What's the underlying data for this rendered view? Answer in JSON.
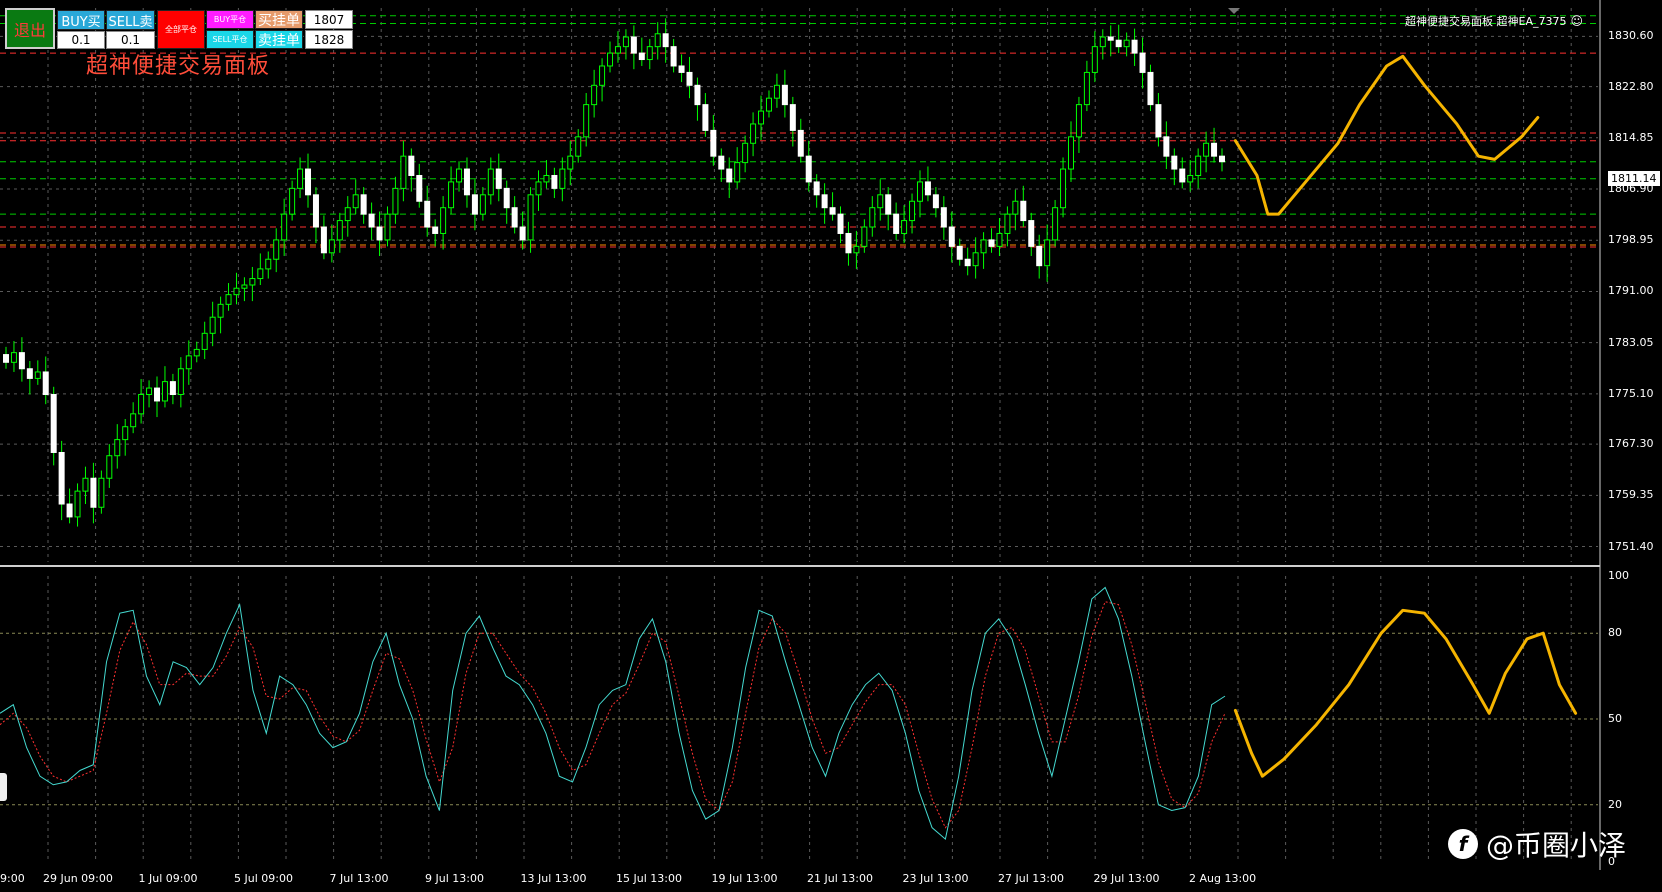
{
  "toolbar": {
    "exit_label": "退出",
    "buy_label": "BUY买",
    "sell_label": "SELL卖",
    "buy_lot": "0.1",
    "sell_lot": "0.1",
    "close_all_label": "全部平仓",
    "buy_close_label": "BUY平仓",
    "sell_close_label": "SELL平仓",
    "buy_pending_label": "买挂单",
    "sell_pending_label": "卖挂单",
    "buy_pending_price": "1807",
    "sell_pending_price": "1828",
    "colors": {
      "exit": "#0a7a12",
      "buy": "#29a8d8",
      "sell": "#29a8d8",
      "close_all": "#ff0000",
      "buy_close": "#ff1cff",
      "sell_close": "#1ad7e8",
      "buy_pending": "#e69a6b",
      "sell_pending": "#1ad7e8"
    }
  },
  "panel_title": "超神便捷交易面板",
  "ea_label": "超神便捷交易面板 超神EA_7375",
  "watermark": "@币圈小泽",
  "current_price": "1811.14",
  "chart_data": [
    {
      "type": "candlestick",
      "y_ticks": [
        "1830.60",
        "1822.80",
        "1814.85",
        "1806.90",
        "1798.95",
        "1791.00",
        "1783.05",
        "1775.10",
        "1767.30",
        "1759.35",
        "1751.40"
      ],
      "x_ticks": [
        "29 Jun 09:00",
        "1 Jul 09:00",
        "5 Jul 09:00",
        "7 Jul 13:00",
        "9 Jul 13:00",
        "13 Jul 13:00",
        "15 Jul 13:00",
        "19 Jul 13:00",
        "21 Jul 13:00",
        "23 Jul 13:00",
        "27 Jul 13:00",
        "29 Jul 13:00",
        "2 Aug 13:00"
      ],
      "x_tick_prefix": "9:00",
      "ylim": [
        1749,
        1835
      ],
      "grid": true,
      "bull_color": "#00ff00",
      "bear_color": "#ffffff",
      "h_levels": [
        {
          "price": 1833.8,
          "color": "#00cc00"
        },
        {
          "price": 1832.6,
          "color": "#00cc00"
        },
        {
          "price": 1828.0,
          "color": "#ff3030"
        },
        {
          "price": 1815.6,
          "color": "#ff3030"
        },
        {
          "price": 1814.4,
          "color": "#ff3030"
        },
        {
          "price": 1811.14,
          "color": "#00cc00"
        },
        {
          "price": 1808.5,
          "color": "#00cc00"
        },
        {
          "price": 1803.0,
          "color": "#00cc00"
        },
        {
          "price": 1801.0,
          "color": "#ff3030"
        },
        {
          "price": 1798.2,
          "color": "#ff8c00"
        },
        {
          "price": 1797.9,
          "color": "#ff3030"
        }
      ],
      "forecast_path": [
        [
          1,
          1814.4
        ],
        [
          5,
          1809
        ],
        [
          7,
          1803
        ],
        [
          9,
          1803
        ],
        [
          14,
          1808
        ],
        [
          20,
          1814
        ],
        [
          24,
          1820
        ],
        [
          29,
          1826
        ],
        [
          32,
          1827.5
        ],
        [
          36,
          1823
        ],
        [
          42,
          1817
        ],
        [
          46,
          1812
        ],
        [
          49,
          1811.5
        ],
        [
          54,
          1815
        ],
        [
          57,
          1818
        ]
      ],
      "closes": [
        1780.0,
        1781.5,
        1779.0,
        1777.5,
        1778.5,
        1775.0,
        1766.0,
        1758.0,
        1756.0,
        1760.0,
        1762.0,
        1757.5,
        1762.0,
        1765.5,
        1768.0,
        1770.0,
        1772.0,
        1775.0,
        1776.0,
        1774.0,
        1777.0,
        1775.0,
        1779.0,
        1781.0,
        1782.0,
        1784.5,
        1787.0,
        1789.0,
        1790.5,
        1791.5,
        1792.0,
        1793.0,
        1794.5,
        1796.0,
        1799.0,
        1803.0,
        1807.0,
        1810.0,
        1806.0,
        1801.0,
        1797.0,
        1799.0,
        1802.0,
        1804.0,
        1806.0,
        1803.0,
        1801.0,
        1799.0,
        1803.0,
        1807.0,
        1812.0,
        1809.0,
        1805.0,
        1801.0,
        1800.0,
        1804.0,
        1808.0,
        1810.0,
        1806.0,
        1803.0,
        1806.0,
        1810.0,
        1807.0,
        1804.0,
        1801.0,
        1799.0,
        1806.0,
        1808.0,
        1809.0,
        1807.0,
        1810.0,
        1812.0,
        1815.0,
        1820.0,
        1823.0,
        1826.0,
        1828.0,
        1829.0,
        1830.5,
        1828.0,
        1827.0,
        1829.0,
        1831.0,
        1829.0,
        1826.0,
        1825.0,
        1823.0,
        1820.0,
        1816.0,
        1812.0,
        1810.0,
        1808.0,
        1811.0,
        1814.0,
        1817.0,
        1819.0,
        1821.0,
        1823.0,
        1820.0,
        1816.0,
        1812.0,
        1808.0,
        1806.0,
        1804.0,
        1803.0,
        1800.0,
        1797.0,
        1798.0,
        1801.0,
        1804.0,
        1806.0,
        1803.0,
        1800.0,
        1802.0,
        1805.0,
        1808.0,
        1806.0,
        1804.0,
        1801.0,
        1798.0,
        1796.0,
        1795.0,
        1797.0,
        1799.0,
        1798.0,
        1800.0,
        1803.0,
        1805.0,
        1802.0,
        1798.0,
        1795.0,
        1799.0,
        1804.0,
        1810.0,
        1815.0,
        1820.0,
        1825.0,
        1829.0,
        1830.5,
        1830.0,
        1829.0,
        1830.0,
        1828.0,
        1825.0,
        1820.0,
        1815.0,
        1812.0,
        1810.0,
        1808.0,
        1809.0,
        1812.0,
        1814.0,
        1812.0,
        1811.14
      ]
    },
    {
      "type": "line",
      "name": "stochastic",
      "y_ticks": [
        "100",
        "80",
        "50",
        "20",
        "0"
      ],
      "ylim": [
        0,
        100
      ],
      "levels": [
        80,
        50,
        20
      ],
      "main_color": "#44d9d0",
      "signal_color": "#ff3030",
      "main": [
        52,
        55,
        40,
        30,
        27,
        28,
        32,
        34,
        70,
        87,
        88,
        65,
        55,
        70,
        68,
        62,
        68,
        80,
        90,
        60,
        45,
        65,
        62,
        55,
        45,
        40,
        42,
        52,
        70,
        80,
        62,
        50,
        30,
        18,
        60,
        80,
        86,
        75,
        65,
        62,
        55,
        45,
        30,
        28,
        40,
        55,
        60,
        62,
        78,
        85,
        70,
        45,
        25,
        15,
        18,
        40,
        68,
        88,
        86,
        70,
        55,
        40,
        30,
        45,
        55,
        62,
        66,
        60,
        45,
        25,
        12,
        8,
        30,
        60,
        80,
        85,
        78,
        62,
        45,
        30,
        50,
        70,
        92,
        96,
        85,
        65,
        42,
        20,
        18,
        19,
        30,
        55,
        58
      ],
      "signal": [
        48,
        52,
        47,
        37,
        30,
        28,
        30,
        32,
        52,
        74,
        84,
        76,
        62,
        62,
        66,
        65,
        65,
        72,
        82,
        75,
        58,
        57,
        61,
        60,
        51,
        44,
        42,
        46,
        60,
        73,
        71,
        60,
        43,
        28,
        40,
        66,
        80,
        80,
        73,
        66,
        61,
        52,
        40,
        32,
        34,
        45,
        55,
        59,
        69,
        80,
        77,
        58,
        38,
        22,
        18,
        28,
        52,
        75,
        85,
        80,
        66,
        50,
        38,
        40,
        48,
        56,
        62,
        62,
        55,
        38,
        22,
        12,
        18,
        40,
        65,
        80,
        82,
        74,
        58,
        42,
        42,
        58,
        79,
        91,
        90,
        76,
        56,
        35,
        22,
        19,
        24,
        42,
        52
      ],
      "forecast_path": [
        [
          1,
          53
        ],
        [
          4,
          38
        ],
        [
          6,
          30
        ],
        [
          10,
          36
        ],
        [
          16,
          48
        ],
        [
          22,
          62
        ],
        [
          28,
          80
        ],
        [
          32,
          88
        ],
        [
          36,
          87
        ],
        [
          40,
          78
        ],
        [
          45,
          62
        ],
        [
          48,
          52
        ],
        [
          51,
          66
        ],
        [
          55,
          78
        ],
        [
          58,
          80
        ],
        [
          61,
          62
        ],
        [
          64,
          52
        ]
      ]
    }
  ]
}
